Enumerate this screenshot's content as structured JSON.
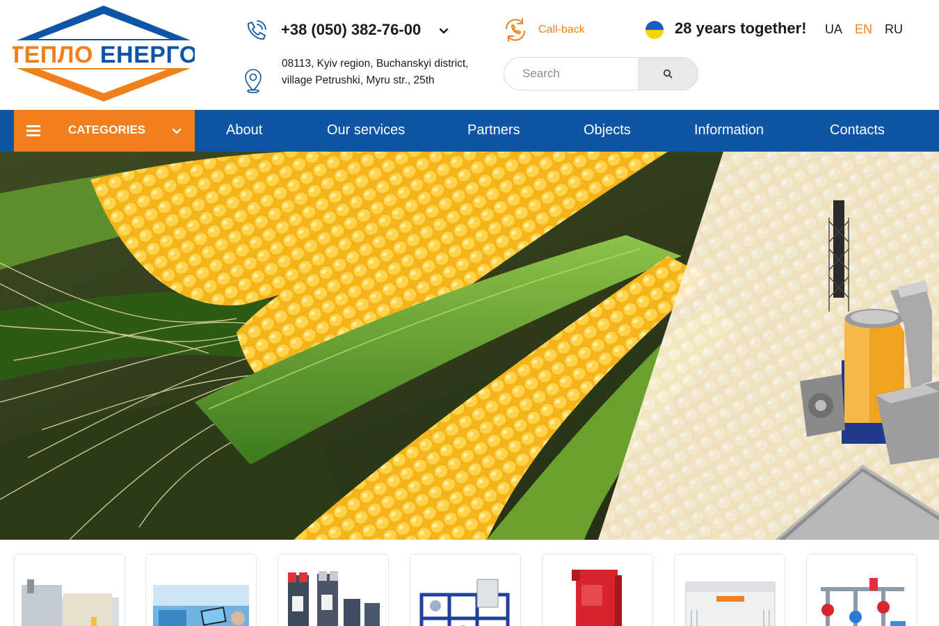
{
  "brand": {
    "logo_text": "ТЕПЛО ЕНЕРГО",
    "colors": {
      "blue": "#0f55a5",
      "orange": "#f07f1c"
    }
  },
  "header": {
    "phone": "+38 (050) 382-76-00",
    "address": "08113, Kyiv region, Buchanskyi district, village Petrushki, Myru str., 25th",
    "callback_label": "Call-back",
    "search_placeholder": "Search",
    "anniversary": "28 years together!",
    "languages": [
      {
        "code": "UA",
        "active": false
      },
      {
        "code": "EN",
        "active": true
      },
      {
        "code": "RU",
        "active": false
      }
    ]
  },
  "nav": {
    "categories_label": "CATEGORIES",
    "items": [
      {
        "label": "About"
      },
      {
        "label": "Our services"
      },
      {
        "label": "Partners"
      },
      {
        "label": "Objects"
      },
      {
        "label": "Information"
      },
      {
        "label": "Contacts"
      }
    ]
  },
  "icons": {
    "phone": "phone-icon",
    "location": "location-pin-icon",
    "callback": "callback-arrows-icon",
    "search": "search-icon",
    "menu": "hamburger-menu-icon",
    "chevron": "chevron-down-icon",
    "flag": "ukraine-flag-icon"
  },
  "hero": {
    "image": "corn cobs with biomass boiler installation illustration"
  },
  "products": [
    {
      "image": "boiler-house-container"
    },
    {
      "image": "control-room-tablet"
    },
    {
      "image": "plate-heat-exchangers"
    },
    {
      "image": "blue-frame-heat-station"
    },
    {
      "image": "red-boiler"
    },
    {
      "image": "white-generator"
    },
    {
      "image": "piping-manifold-unit"
    }
  ]
}
